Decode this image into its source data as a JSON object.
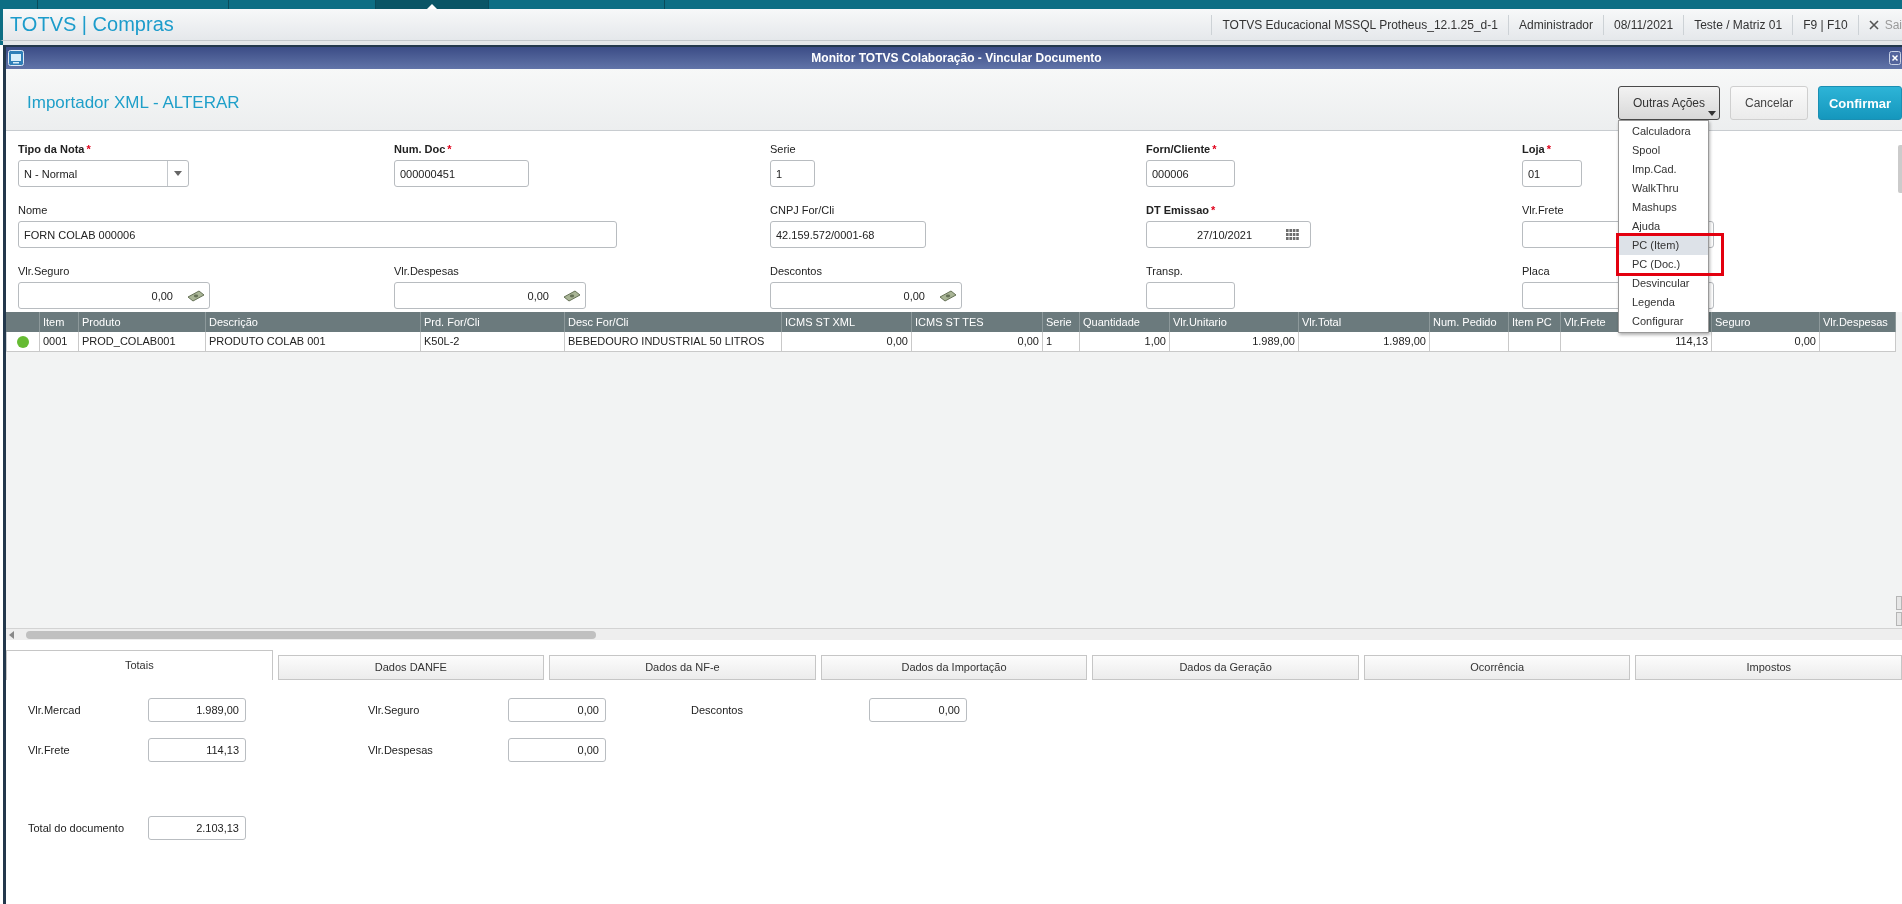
{
  "app_bar": {
    "window_tabs": [
      {
        "selected": false
      },
      {
        "selected": false
      },
      {
        "selected": false
      },
      {
        "selected": true
      },
      {
        "selected": false
      }
    ],
    "title": "TOTVS | Compras",
    "status_items": [
      "TOTVS Educacional MSSQL Protheus_12.1.25_d-1",
      "Administrador",
      "08/11/2021",
      "Teste / Matriz 01",
      "F9 | F10"
    ],
    "exit_label": "Sai"
  },
  "window": {
    "title": "Monitor TOTVS Colaboração - Vincular Documento"
  },
  "header": {
    "title": "Importador XML - ALTERAR",
    "buttons": [
      {
        "label": "Outras Ações",
        "kind": "menu",
        "expanded": true
      },
      {
        "label": "Cancelar",
        "kind": "secondary"
      },
      {
        "label": "Confirmar",
        "kind": "primary"
      }
    ]
  },
  "actions_menu": {
    "items": [
      {
        "label": "Calculadora",
        "selected": false,
        "outlined": false
      },
      {
        "label": "Spool",
        "selected": false,
        "outlined": false
      },
      {
        "label": "Imp.Cad.",
        "selected": false,
        "outlined": false
      },
      {
        "label": "WalkThru",
        "selected": false,
        "outlined": false
      },
      {
        "label": "Mashups",
        "selected": false,
        "outlined": false
      },
      {
        "label": "Ajuda",
        "selected": false,
        "outlined": false
      },
      {
        "label": "PC (Item)",
        "selected": true,
        "outlined": true
      },
      {
        "label": "PC (Doc.)",
        "selected": false,
        "outlined": true
      },
      {
        "label": "Desvincular",
        "selected": false,
        "outlined": false
      },
      {
        "label": "Legenda",
        "selected": false,
        "outlined": false
      },
      {
        "label": "Configurar",
        "selected": false,
        "outlined": false
      }
    ]
  },
  "form": {
    "rows": [
      [
        {
          "label": "Tipo da Nota",
          "required": "*",
          "kind": "select",
          "value": "N - Normal"
        },
        {
          "label": "Num. Doc",
          "required": "*",
          "kind": "text",
          "value": "000000451"
        },
        {
          "label": "Serie",
          "kind": "text",
          "value": "1"
        },
        {
          "label": "Forn/Cliente",
          "required": "*",
          "kind": "text",
          "value": "000006"
        },
        {
          "label": "Loja",
          "required": "*",
          "kind": "text",
          "value": "01"
        }
      ],
      [
        {
          "label": "Nome",
          "kind": "text",
          "value": "FORN COLAB 000006"
        },
        null,
        {
          "label": "CNPJ For/Cli",
          "kind": "text",
          "value": "42.159.572/0001-68"
        },
        {
          "label": "DT Emissao",
          "required": "*",
          "kind": "date",
          "value": "27/10/2021"
        },
        {
          "label": "Vlr.Frete",
          "kind": "text"
        }
      ],
      [
        {
          "label": "Vlr.Seguro",
          "kind": "money",
          "value": "0,00"
        },
        {
          "label": "Vlr.Despesas",
          "kind": "money",
          "value": "0,00"
        },
        {
          "label": "Descontos",
          "kind": "money",
          "value": "0,00"
        },
        {
          "label": "Transp.",
          "kind": "text"
        },
        {
          "label": "Placa",
          "kind": "text"
        }
      ]
    ]
  },
  "table": {
    "columns": [
      {
        "label": "Item",
        "kind": "text"
      },
      {
        "label": "Produto",
        "kind": "text"
      },
      {
        "label": "Descrição",
        "kind": "text"
      },
      {
        "label": "Prd. For/Cli",
        "kind": "text"
      },
      {
        "label": "Desc For/Cli",
        "kind": "text"
      },
      {
        "label": "ICMS ST XML",
        "kind": "number"
      },
      {
        "label": "ICMS ST TES",
        "kind": "number"
      },
      {
        "label": "Serie",
        "kind": "text"
      },
      {
        "label": "Quantidade",
        "kind": "number"
      },
      {
        "label": "Vlr.Unitario",
        "kind": "number"
      },
      {
        "label": "Vlr.Total",
        "kind": "number"
      },
      {
        "label": "Num. Pedido",
        "kind": "text"
      },
      {
        "label": "Item PC",
        "kind": "text"
      },
      {
        "label": "Vlr.Frete",
        "kind": "number"
      },
      {
        "label": "Seguro",
        "kind": "number"
      },
      {
        "label": "Vlr.Despesas",
        "kind": "number"
      }
    ],
    "rows": [
      {
        "color": "#66bb33",
        "cells": [
          "0001",
          "PROD_COLAB001",
          "PRODUTO COLAB 001",
          "K50L-2",
          "BEBEDOURO INDUSTRIAL 50 LITROS",
          "0,00",
          "0,00",
          "1",
          "1,00",
          "1.989,00",
          "1.989,00",
          null,
          null,
          "114,13",
          "0,00",
          null
        ]
      }
    ]
  },
  "tabs": [
    {
      "label": "Totais",
      "selected": true
    },
    {
      "label": "Dados DANFE",
      "selected": false
    },
    {
      "label": "Dados da NF-e",
      "selected": false
    },
    {
      "label": "Dados da Importação",
      "selected": false
    },
    {
      "label": "Dados da Geração",
      "selected": false
    },
    {
      "label": "Ocorrência",
      "selected": false
    },
    {
      "label": "Impostos",
      "selected": false
    }
  ],
  "totals": {
    "rows": [
      [
        {
          "label": "Vlr.Mercad",
          "value": "1.989,00"
        },
        {
          "label": "Vlr.Seguro",
          "value": "0,00"
        },
        {
          "label": "Descontos",
          "value": "0,00"
        }
      ],
      [
        {
          "label": "Vlr.Frete",
          "value": "114,13"
        },
        {
          "label": "Vlr.Despesas",
          "value": "0,00"
        }
      ]
    ],
    "total": {
      "label": "Total do documento",
      "value": "2.103,13"
    }
  }
}
